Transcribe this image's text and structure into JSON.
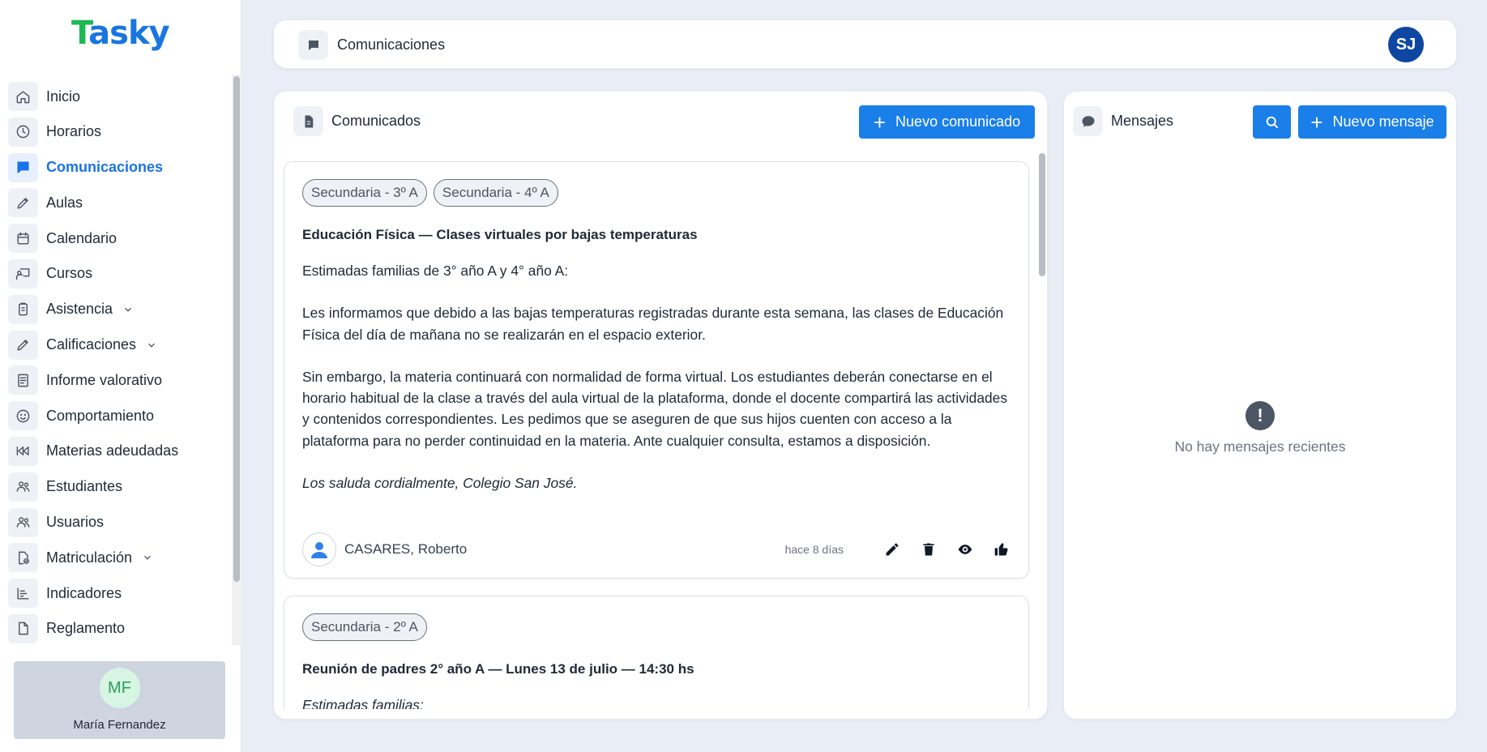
{
  "app": {
    "logo": "Tasky"
  },
  "sidebar": {
    "items": [
      {
        "label": "Inicio",
        "icon": "home-icon"
      },
      {
        "label": "Horarios",
        "icon": "clock-icon"
      },
      {
        "label": "Comunicaciones",
        "icon": "chat-icon",
        "active": true
      },
      {
        "label": "Aulas",
        "icon": "pencil-icon"
      },
      {
        "label": "Calendario",
        "icon": "calendar-icon"
      },
      {
        "label": "Cursos",
        "icon": "teacher-board-icon"
      },
      {
        "label": "Asistencia",
        "icon": "clipboard-icon",
        "expandable": true
      },
      {
        "label": "Calificaciones",
        "icon": "pencil-icon",
        "expandable": true
      },
      {
        "label": "Informe valorativo",
        "icon": "report-icon"
      },
      {
        "label": "Comportamiento",
        "icon": "smile-icon"
      },
      {
        "label": "Materias adeudadas",
        "icon": "rewind-icon"
      },
      {
        "label": "Estudiantes",
        "icon": "users-icon"
      },
      {
        "label": "Usuarios",
        "icon": "users-icon"
      },
      {
        "label": "Matriculación",
        "icon": "file-check-icon",
        "expandable": true
      },
      {
        "label": "Indicadores",
        "icon": "bar-chart-icon"
      },
      {
        "label": "Reglamento",
        "icon": "document-icon"
      }
    ],
    "user": {
      "initials": "MF",
      "name": "María Fernandez"
    }
  },
  "header": {
    "title": "Comunicaciones",
    "avatar_initials": "SJ"
  },
  "comunicados": {
    "title": "Comunicados",
    "new_button": "Nuevo comunicado",
    "items": [
      {
        "tags": [
          "Secundaria - 3º A",
          "Secundaria - 4º A"
        ],
        "title": "Educación Física — Clases virtuales por bajas temperaturas",
        "body": [
          "Estimadas familias de 3° año A y 4° año A:",
          "Les informamos que debido a las bajas temperaturas registradas durante esta semana, las clases de Educación Física del día de mañana no se realizarán en el espacio exterior.",
          "Sin embargo, la materia continuará con normalidad de forma virtual. Los estudiantes deberán conectarse en el horario habitual de la clase a través del aula virtual de la plataforma, donde el docente compartirá las actividades y contenidos correspondientes. Les pedimos que se aseguren de que sus hijos cuenten con acceso a la plataforma para no perder continuidad en la materia. Ante cualquier consulta, estamos a disposición."
        ],
        "signature": "Los saluda cordialmente, Colegio San José.",
        "author": "CASARES, Roberto",
        "time": "hace 8 días"
      },
      {
        "tags": [
          "Secundaria - 2º A"
        ],
        "title": "Reunión de padres 2° año A — Lunes 13 de julio — 14:30 hs",
        "body_preview": "Estimadas familias:"
      }
    ]
  },
  "mensajes": {
    "title": "Mensajes",
    "new_button": "Nuevo mensaje",
    "empty_text": "No hay mensajes recientes"
  }
}
